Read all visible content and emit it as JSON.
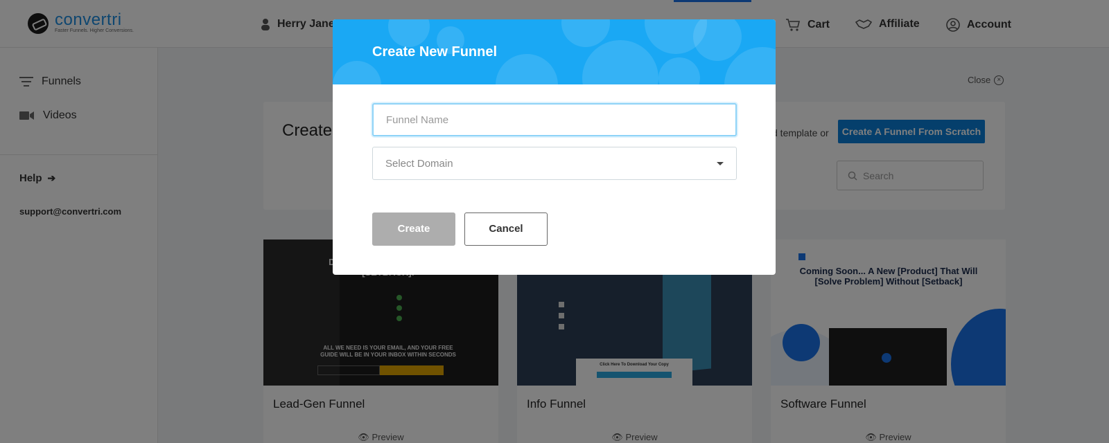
{
  "header": {
    "brand_name": "convertri",
    "brand_tagline": "Faster Funnels. Higher Conversions.",
    "user_name": "Herry Jane",
    "nav": [
      {
        "label": "Cart",
        "icon": "cart-icon"
      },
      {
        "label": "Affiliate",
        "icon": "handshake-icon"
      },
      {
        "label": "Account",
        "icon": "account-icon"
      }
    ]
  },
  "sidebar": {
    "items": [
      {
        "label": "Funnels",
        "icon": "filter-lines-icon"
      },
      {
        "label": "Videos",
        "icon": "video-camera-icon"
      }
    ],
    "help_label": "Help",
    "support_email": "support@convertri.com"
  },
  "main": {
    "close_label": "Close",
    "panel_title": "Create",
    "template_or_text": "d template or",
    "scratch_button": "Create A Funnel From Scratch",
    "search_placeholder": "Search",
    "cards": [
      {
        "title": "Lead-Gen Funnel",
        "preview_label": "Preview",
        "thumb_heading": "DOWNLO... [NU... WITHOUT [SETBACK]!",
        "thumb_sub": "ALL WE NEED IS YOUR EMAIL, AND YOUR FREE GUIDE WILL BE IN YOUR INBOX WITHIN SECONDS"
      },
      {
        "title": "Info Funnel",
        "preview_label": "Preview",
        "thumb_button": "Click Here To Download Your Copy"
      },
      {
        "title": "Software Funnel",
        "preview_label": "Preview",
        "thumb_heading": "Coming Soon... A New [Product] That Will [Solve Problem] Without [Setback]"
      }
    ]
  },
  "modal": {
    "title": "Create New Funnel",
    "funnel_name_placeholder": "Funnel Name",
    "funnel_name_value": "",
    "domain_placeholder": "Select Domain",
    "create_label": "Create",
    "cancel_label": "Cancel"
  },
  "colors": {
    "modal_header": "#1aa8f4",
    "scratch_button": "#0a7ed9",
    "create_disabled": "#adadad"
  }
}
